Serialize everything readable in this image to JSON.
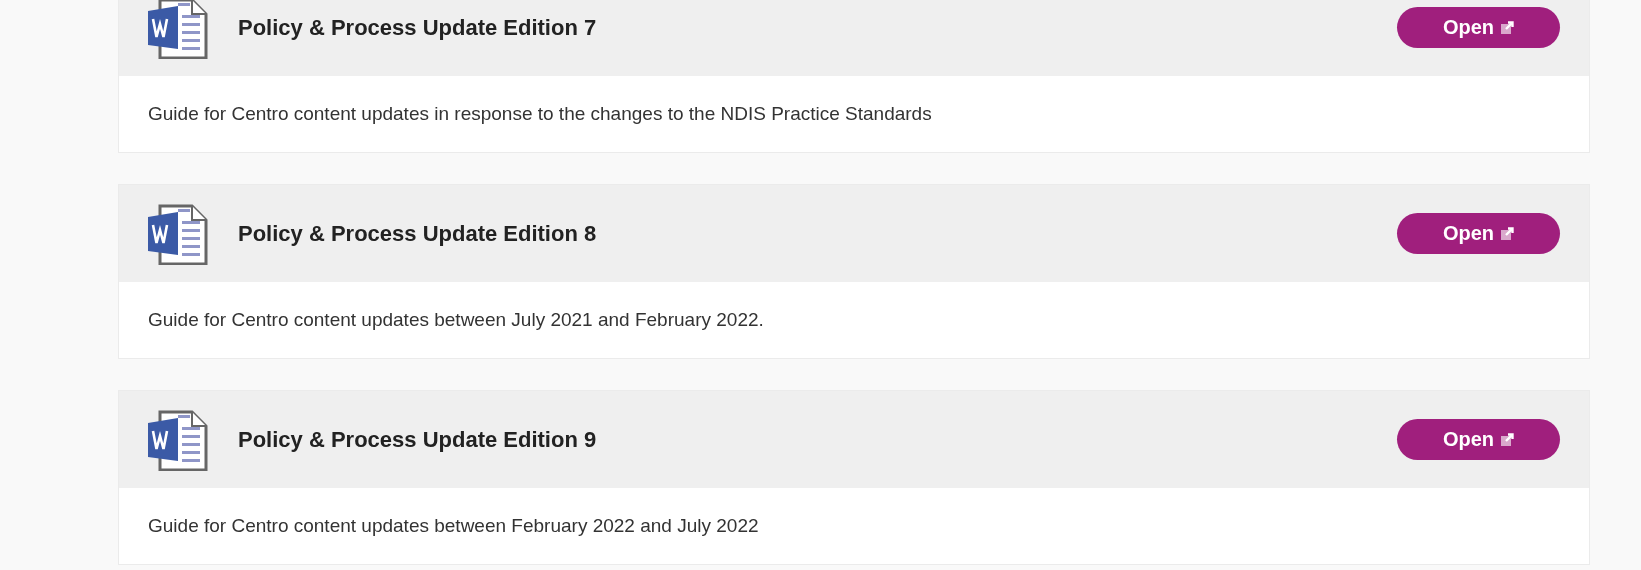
{
  "documents": [
    {
      "title": "Policy & Process Update Edition 7",
      "button": "Open",
      "description": "Guide for Centro content updates in response to the changes to the NDIS Practice Standards"
    },
    {
      "title": "Policy & Process Update Edition 8",
      "button": "Open",
      "description": "Guide for Centro content updates between July 2021 and February 2022."
    },
    {
      "title": "Policy & Process Update Edition 9",
      "button": "Open",
      "description": "Guide for Centro content updates between February 2022 and July 2022"
    }
  ]
}
